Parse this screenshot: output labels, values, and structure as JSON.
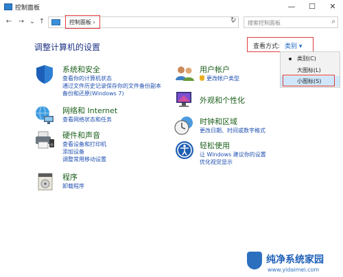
{
  "window": {
    "title": "控制面板",
    "minimize": "—",
    "maximize": "☐",
    "close": "✕"
  },
  "nav": {
    "back": "←",
    "forward": "→",
    "recent": "⌄",
    "up": "↑",
    "breadcrumb": "控制面板",
    "breadcrumb_sep": "›",
    "address_dropdown": "⌄",
    "refresh": "↻",
    "search_placeholder": "搜索控制面板",
    "search_icon": "⌕"
  },
  "main": {
    "heading": "调整计算机的设置",
    "view_by_label": "查看方式:",
    "view_by_value": "类别 ▾",
    "view_menu": [
      {
        "label": "类别(C)",
        "selected": true
      },
      {
        "label": "大图标(L)",
        "selected": false
      },
      {
        "label": "小图标(S)",
        "selected": false,
        "highlighted": true
      }
    ]
  },
  "categories_left": [
    {
      "title": "系统和安全",
      "icon": "shield-icon",
      "links": [
        "查看你的计算机状态",
        "通过文件历史记录保存你的文件备份副本",
        "备份和还原(Windows 7)"
      ]
    },
    {
      "title": "网络和 Internet",
      "icon": "network-globe-icon",
      "links": [
        "查看网络状态和任务"
      ]
    },
    {
      "title": "硬件和声音",
      "icon": "printer-icon",
      "links": [
        "查看设备和打印机",
        "添加设备",
        "调整常用移动设置"
      ]
    },
    {
      "title": "程序",
      "icon": "programs-icon",
      "links": [
        "卸载程序"
      ]
    }
  ],
  "categories_right": [
    {
      "title": "用户帐户",
      "icon": "users-icon",
      "links": [
        "更改帐户类型"
      ]
    },
    {
      "title": "外观和个性化",
      "icon": "monitor-icon",
      "links": []
    },
    {
      "title": "时钟和区域",
      "icon": "clock-globe-icon",
      "links": [
        "更改日期、时间或数字格式"
      ]
    },
    {
      "title": "轻松使用",
      "icon": "ease-of-access-icon",
      "links": [
        "让 Windows 建议你的设置",
        "优化视觉显示"
      ]
    }
  ],
  "watermark": {
    "title": "纯净系统家园",
    "url": "www.yidaimei.com"
  },
  "colors": {
    "heading": "#1e3287",
    "category_title": "#1a5e1a",
    "link": "#1e4fb0",
    "highlight_box": "#e03b3b",
    "menu_hover": "#cfe6fb"
  }
}
